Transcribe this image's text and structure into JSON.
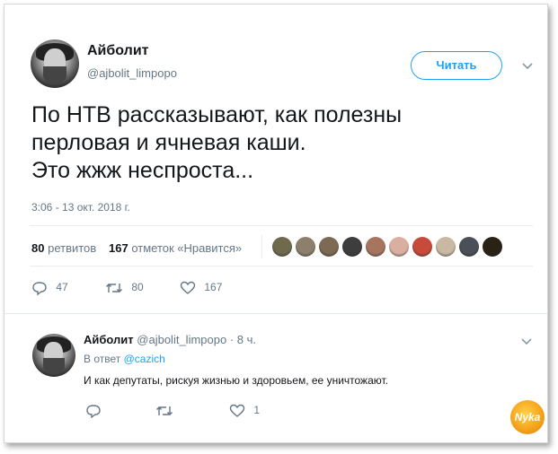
{
  "tweet": {
    "author_name": "Айболит",
    "author_handle": "@ajbolit_limpopo",
    "follow_label": "Читать",
    "text_lines": [
      "По НТВ рассказывают, как полезны",
      "перловая и ячневая каши.",
      "Это жжж неспроста..."
    ],
    "timestamp": "3:06 - 13 окт. 2018 г.",
    "retweets_count": "80",
    "retweets_label": "ретвитов",
    "likes_count": "167",
    "likes_label": "отметок «Нравится»",
    "reply_count": "47",
    "retweet_action_count": "80",
    "like_action_count": "167",
    "liker_avatar_colors": [
      "#6f6a4e",
      "#8c7f6c",
      "#7d6a52",
      "#3d3d3d",
      "#a57560",
      "#d9b0a0",
      "#c74a3a",
      "#c9b9a3",
      "#4a4f58",
      "#2b2216"
    ]
  },
  "reply": {
    "author_name": "Айболит",
    "author_handle": "@ajbolit_limpopo",
    "time": "· 8 ч.",
    "in_reply_prefix": "В ответ",
    "in_reply_to": "@cazich",
    "text": "И как депутаты, рискуя жизнью и здоровьем, ее уничтожают.",
    "like_count": "1"
  },
  "watermark": {
    "text": "Nyka"
  },
  "icons": [
    "chevron-down-icon",
    "reply-icon",
    "retweet-icon",
    "heart-icon"
  ],
  "colors": {
    "accent": "#1da1f2",
    "muted": "#657786"
  }
}
